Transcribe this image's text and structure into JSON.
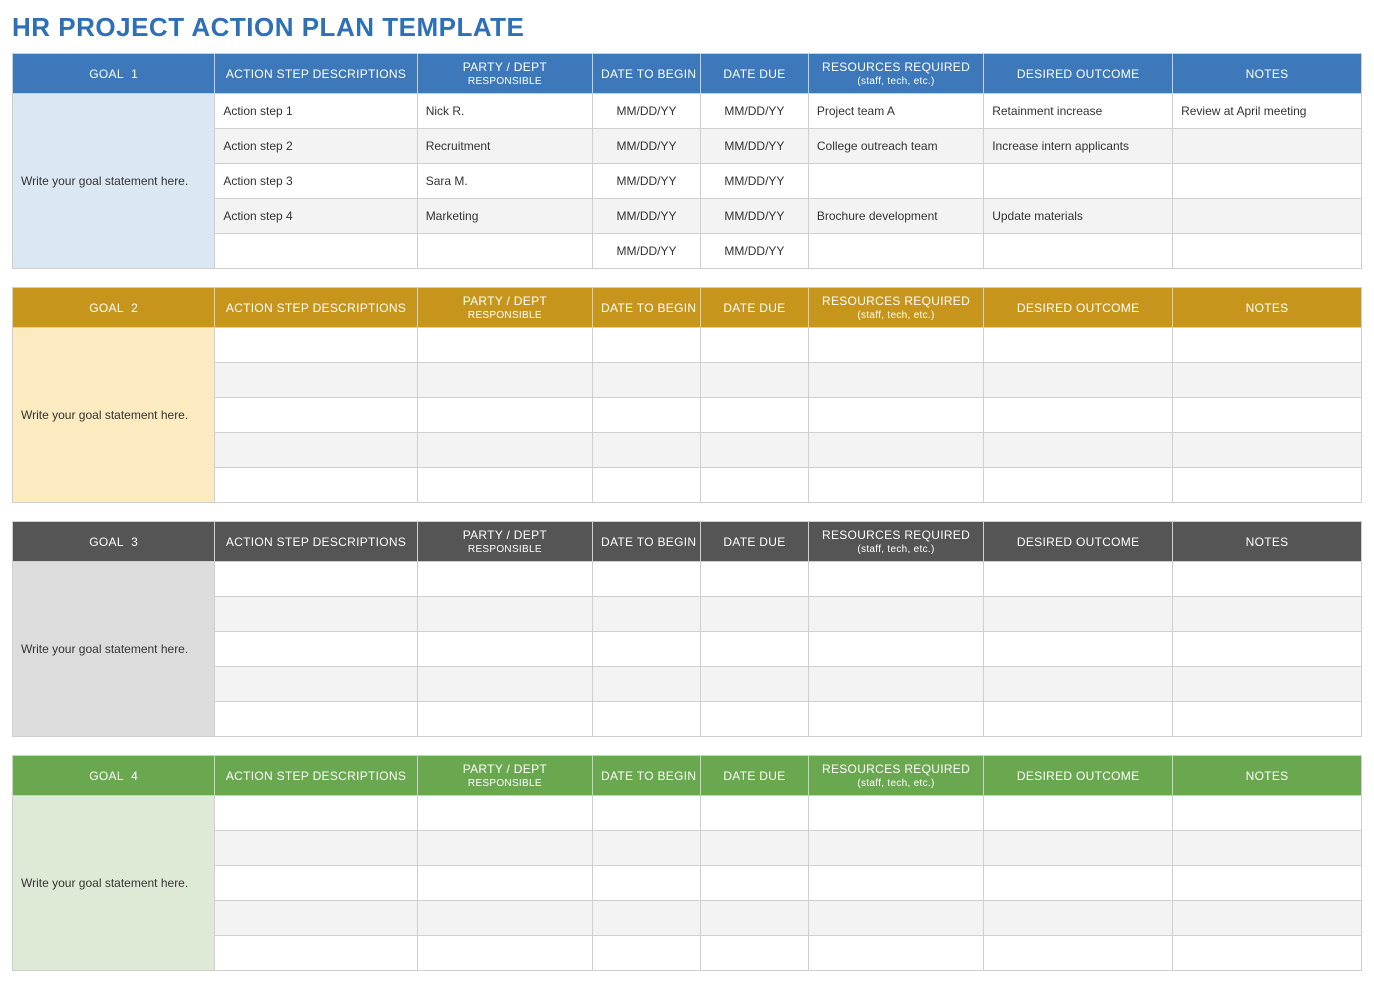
{
  "title": "HR PROJECT ACTION PLAN TEMPLATE",
  "headers": {
    "goal_prefix": "GOAL",
    "action": "ACTION STEP DESCRIPTIONS",
    "party": "PARTY / DEPT",
    "party_sub": "RESPONSIBLE",
    "begin": "DATE TO BEGIN",
    "due": "DATE DUE",
    "resources": "RESOURCES REQUIRED",
    "resources_sub": "(staff, tech, etc.)",
    "outcome": "DESIRED OUTCOME",
    "notes": "NOTES"
  },
  "goals": [
    {
      "number": "1",
      "statement": "Write your goal statement here.",
      "rows": [
        {
          "action": "Action step 1",
          "party": "Nick R.",
          "begin": "MM/DD/YY",
          "due": "MM/DD/YY",
          "resources": "Project team A",
          "outcome": "Retainment increase",
          "notes": "Review at April meeting"
        },
        {
          "action": "Action step 2",
          "party": "Recruitment",
          "begin": "MM/DD/YY",
          "due": "MM/DD/YY",
          "resources": "College outreach team",
          "outcome": "Increase intern applicants",
          "notes": ""
        },
        {
          "action": "Action step 3",
          "party": "Sara M.",
          "begin": "MM/DD/YY",
          "due": "MM/DD/YY",
          "resources": "",
          "outcome": "",
          "notes": ""
        },
        {
          "action": "Action step 4",
          "party": "Marketing",
          "begin": "MM/DD/YY",
          "due": "MM/DD/YY",
          "resources": "Brochure development",
          "outcome": "Update materials",
          "notes": ""
        },
        {
          "action": "",
          "party": "",
          "begin": "MM/DD/YY",
          "due": "MM/DD/YY",
          "resources": "",
          "outcome": "",
          "notes": ""
        }
      ]
    },
    {
      "number": "2",
      "statement": "Write your goal statement here.",
      "rows": [
        {
          "action": "",
          "party": "",
          "begin": "",
          "due": "",
          "resources": "",
          "outcome": "",
          "notes": ""
        },
        {
          "action": "",
          "party": "",
          "begin": "",
          "due": "",
          "resources": "",
          "outcome": "",
          "notes": ""
        },
        {
          "action": "",
          "party": "",
          "begin": "",
          "due": "",
          "resources": "",
          "outcome": "",
          "notes": ""
        },
        {
          "action": "",
          "party": "",
          "begin": "",
          "due": "",
          "resources": "",
          "outcome": "",
          "notes": ""
        },
        {
          "action": "",
          "party": "",
          "begin": "",
          "due": "",
          "resources": "",
          "outcome": "",
          "notes": ""
        }
      ]
    },
    {
      "number": "3",
      "statement": "Write your goal statement here.",
      "rows": [
        {
          "action": "",
          "party": "",
          "begin": "",
          "due": "",
          "resources": "",
          "outcome": "",
          "notes": ""
        },
        {
          "action": "",
          "party": "",
          "begin": "",
          "due": "",
          "resources": "",
          "outcome": "",
          "notes": ""
        },
        {
          "action": "",
          "party": "",
          "begin": "",
          "due": "",
          "resources": "",
          "outcome": "",
          "notes": ""
        },
        {
          "action": "",
          "party": "",
          "begin": "",
          "due": "",
          "resources": "",
          "outcome": "",
          "notes": ""
        },
        {
          "action": "",
          "party": "",
          "begin": "",
          "due": "",
          "resources": "",
          "outcome": "",
          "notes": ""
        }
      ]
    },
    {
      "number": "4",
      "statement": "Write your goal statement here.",
      "rows": [
        {
          "action": "",
          "party": "",
          "begin": "",
          "due": "",
          "resources": "",
          "outcome": "",
          "notes": ""
        },
        {
          "action": "",
          "party": "",
          "begin": "",
          "due": "",
          "resources": "",
          "outcome": "",
          "notes": ""
        },
        {
          "action": "",
          "party": "",
          "begin": "",
          "due": "",
          "resources": "",
          "outcome": "",
          "notes": ""
        },
        {
          "action": "",
          "party": "",
          "begin": "",
          "due": "",
          "resources": "",
          "outcome": "",
          "notes": ""
        },
        {
          "action": "",
          "party": "",
          "begin": "",
          "due": "",
          "resources": "",
          "outcome": "",
          "notes": ""
        }
      ]
    }
  ]
}
